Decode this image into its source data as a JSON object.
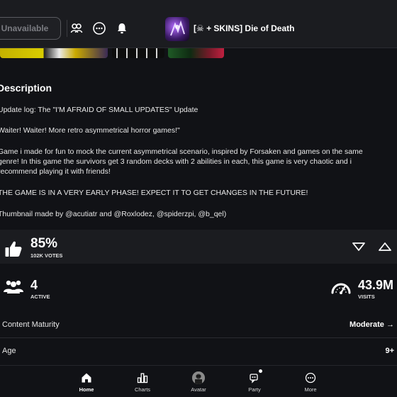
{
  "topbar": {
    "unavailable_label": "Unavailable",
    "game_title": "[☠ + SKINS] Die of Death"
  },
  "description": {
    "heading": "Description",
    "lines": [
      "Update log: The \"I'M AFRAID OF SMALL UPDATES\" Update",
      "Waiter! Waiter! More retro asymmetrical horror games!\"",
      "Game i made for fun to mock the current asymmetrical scenario, inspired by Forsaken and games on the same",
      "genre! In this game the survivors get 3 random decks with 2 abilities in each, this game is very chaotic and i",
      "recommend playing it with friends!",
      "THE GAME IS IN A VERY EARLY PHASE! EXPECT IT TO GET CHANGES IN THE FUTURE!",
      "Thumbnail made by @acutiatr and @Roxlodez, @spiderzpi, @b_qel)"
    ]
  },
  "votes": {
    "percent": "85%",
    "count_label": "102K VOTES"
  },
  "stats": {
    "active_value": "4",
    "active_label": "ACTIVE",
    "visits_value": "43.9M",
    "visits_label": "VISITS"
  },
  "rows": {
    "content_maturity_label": "Content Maturity",
    "content_maturity_value": "Moderate →",
    "age_label": "Age",
    "age_value": "9+"
  },
  "nav": {
    "home": "Home",
    "charts": "Charts",
    "avatar": "Avatar",
    "party": "Party",
    "more": "More"
  },
  "colors": {
    "background": "#111216",
    "panel": "#1b1c20",
    "text": "#ffffff"
  }
}
